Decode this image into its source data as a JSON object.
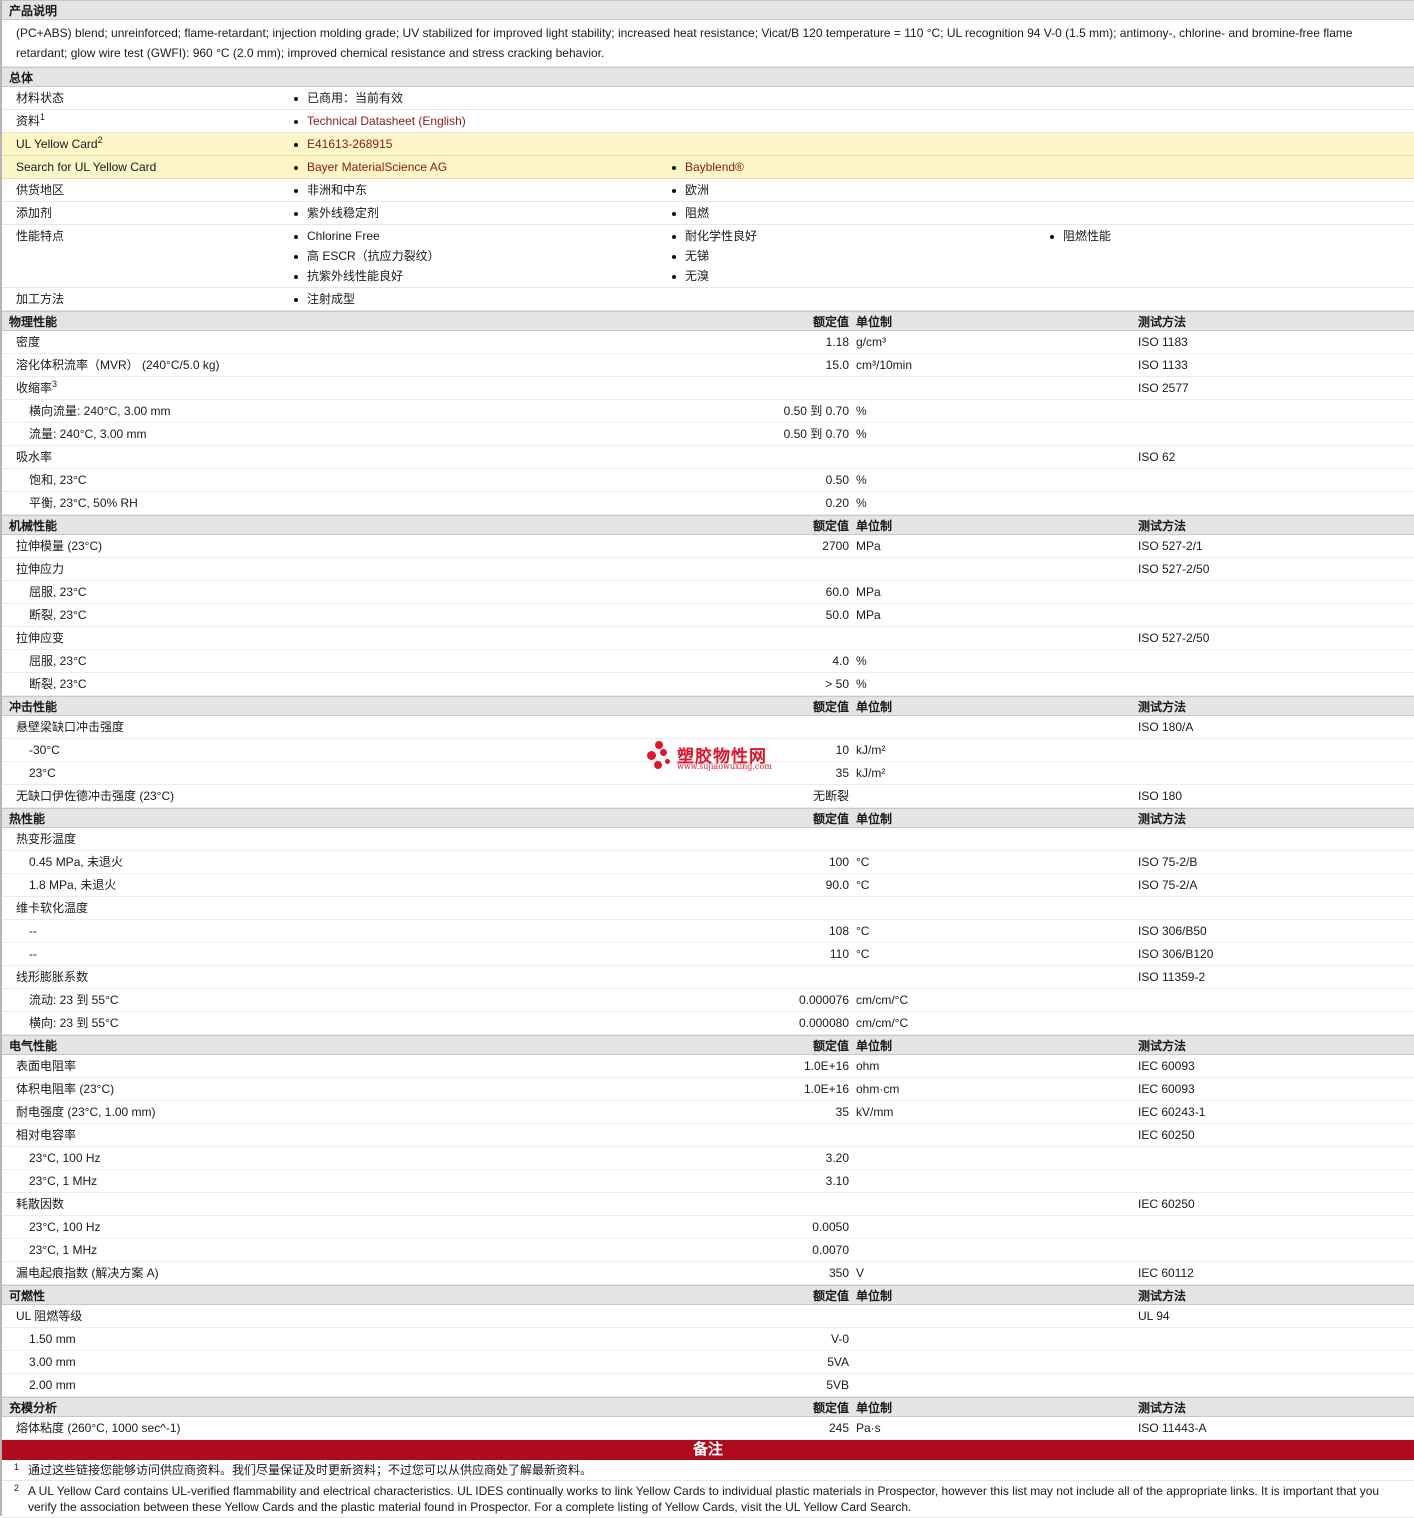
{
  "product_description": {
    "heading": "产品说明",
    "text": "(PC+ABS) blend; unreinforced; flame-retardant; injection molding grade; UV stabilized for improved light stability; increased heat resistance; Vicat/B 120 temperature = 110 °C; UL recognition 94 V-0 (1.5 mm); antimony-, chlorine- and bromine-free flame retardant; glow wire test (GWFI): 960 °C (2.0 mm); improved chemical resistance and stress cracking behavior."
  },
  "general": {
    "heading": "总体",
    "rows": [
      {
        "label": "材料状态",
        "sup": "",
        "highlight": false,
        "cols": [
          [
            "已商用：当前有效"
          ],
          [],
          []
        ],
        "link": false
      },
      {
        "label": "资料",
        "sup": "1",
        "highlight": false,
        "cols": [
          [
            "Technical Datasheet (English)"
          ],
          [],
          []
        ],
        "link": true
      },
      {
        "label": "UL Yellow Card",
        "sup": "2",
        "highlight": true,
        "cols": [
          [
            "E41613-268915"
          ],
          [],
          []
        ],
        "link": true
      },
      {
        "label": "Search for UL Yellow Card",
        "sup": "",
        "highlight": true,
        "cols": [
          [
            "Bayer MaterialScience AG"
          ],
          [
            "Bayblend®"
          ],
          []
        ],
        "link": true
      },
      {
        "label": "供货地区",
        "sup": "",
        "highlight": false,
        "cols": [
          [
            "非洲和中东"
          ],
          [
            "欧洲"
          ],
          []
        ],
        "link": false
      },
      {
        "label": "添加剂",
        "sup": "",
        "highlight": false,
        "cols": [
          [
            "紫外线稳定剂"
          ],
          [
            "阻燃"
          ],
          []
        ],
        "link": false
      },
      {
        "label": "性能特点",
        "sup": "",
        "highlight": false,
        "cols": [
          [
            "Chlorine Free",
            "高 ESCR（抗应力裂纹）",
            "抗紫外线性能良好"
          ],
          [
            "耐化学性良好",
            "无锑",
            "无溴"
          ],
          [
            "阻燃性能"
          ]
        ],
        "link": false
      },
      {
        "label": "加工方法",
        "sup": "",
        "highlight": false,
        "cols": [
          [
            "注射成型"
          ],
          [],
          []
        ],
        "link": false
      }
    ]
  },
  "column_headers": {
    "value": "额定值",
    "unit": "单位制",
    "test": "测试方法"
  },
  "sections": [
    {
      "title": "物理性能",
      "rows": [
        {
          "label": "密度",
          "sub": false,
          "value": "1.18",
          "unit": "g/cm³",
          "test": "ISO 1183"
        },
        {
          "label": "溶化体积流率（MVR） (240°C/5.0 kg)",
          "sub": false,
          "value": "15.0",
          "unit": "cm³/10min",
          "test": "ISO 1133"
        },
        {
          "label": "收缩率",
          "sup": "3",
          "sub": false,
          "value": "",
          "unit": "",
          "test": "ISO 2577"
        },
        {
          "label": "横向流量: 240°C, 3.00 mm",
          "sub": true,
          "value": "0.50 到 0.70",
          "unit": "%",
          "test": ""
        },
        {
          "label": "流量: 240°C, 3.00 mm",
          "sub": true,
          "value": "0.50 到 0.70",
          "unit": "%",
          "test": ""
        },
        {
          "label": "吸水率",
          "sub": false,
          "value": "",
          "unit": "",
          "test": "ISO 62"
        },
        {
          "label": "饱和, 23°C",
          "sub": true,
          "value": "0.50",
          "unit": "%",
          "test": ""
        },
        {
          "label": "平衡, 23°C, 50% RH",
          "sub": true,
          "value": "0.20",
          "unit": "%",
          "test": ""
        }
      ]
    },
    {
      "title": "机械性能",
      "rows": [
        {
          "label": "拉伸模量 (23°C)",
          "sub": false,
          "value": "2700",
          "unit": "MPa",
          "test": "ISO 527-2/1"
        },
        {
          "label": "拉伸应力",
          "sub": false,
          "value": "",
          "unit": "",
          "test": "ISO 527-2/50"
        },
        {
          "label": "屈服, 23°C",
          "sub": true,
          "value": "60.0",
          "unit": "MPa",
          "test": ""
        },
        {
          "label": "断裂, 23°C",
          "sub": true,
          "value": "50.0",
          "unit": "MPa",
          "test": ""
        },
        {
          "label": "拉伸应变",
          "sub": false,
          "value": "",
          "unit": "",
          "test": "ISO 527-2/50"
        },
        {
          "label": "屈服, 23°C",
          "sub": true,
          "value": "4.0",
          "unit": "%",
          "test": ""
        },
        {
          "label": "断裂, 23°C",
          "sub": true,
          "value": "> 50",
          "unit": "%",
          "test": ""
        }
      ]
    },
    {
      "title": "冲击性能",
      "rows": [
        {
          "label": "悬壁梁缺口冲击强度",
          "sub": false,
          "value": "",
          "unit": "",
          "test": "ISO 180/A"
        },
        {
          "label": "-30°C",
          "sub": true,
          "value": "10",
          "unit": "kJ/m²",
          "test": ""
        },
        {
          "label": "23°C",
          "sub": true,
          "value": "35",
          "unit": "kJ/m²",
          "test": ""
        },
        {
          "label": "无缺口伊佐德冲击强度 (23°C)",
          "sub": false,
          "value": "无断裂",
          "unit": "",
          "test": "ISO 180"
        }
      ]
    },
    {
      "title": "热性能",
      "rows": [
        {
          "label": "热变形温度",
          "sub": false,
          "value": "",
          "unit": "",
          "test": ""
        },
        {
          "label": "0.45 MPa, 未退火",
          "sub": true,
          "value": "100",
          "unit": "°C",
          "test": "ISO 75-2/B"
        },
        {
          "label": "1.8 MPa, 未退火",
          "sub": true,
          "value": "90.0",
          "unit": "°C",
          "test": "ISO 75-2/A"
        },
        {
          "label": "维卡软化温度",
          "sub": false,
          "value": "",
          "unit": "",
          "test": ""
        },
        {
          "label": "--",
          "sub": true,
          "value": "108",
          "unit": "°C",
          "test": "ISO 306/B50"
        },
        {
          "label": "--",
          "sub": true,
          "value": "110",
          "unit": "°C",
          "test": "ISO 306/B120"
        },
        {
          "label": "线形膨胀系数",
          "sub": false,
          "value": "",
          "unit": "",
          "test": "ISO 11359-2"
        },
        {
          "label": "流动: 23 到 55°C",
          "sub": true,
          "value": "0.000076",
          "unit": "cm/cm/°C",
          "test": ""
        },
        {
          "label": "横向: 23 到 55°C",
          "sub": true,
          "value": "0.000080",
          "unit": "cm/cm/°C",
          "test": ""
        }
      ]
    },
    {
      "title": "电气性能",
      "rows": [
        {
          "label": "表面电阻率",
          "sub": false,
          "value": "1.0E+16",
          "unit": "ohm",
          "test": "IEC 60093"
        },
        {
          "label": "体积电阻率 (23°C)",
          "sub": false,
          "value": "1.0E+16",
          "unit": "ohm·cm",
          "test": "IEC 60093"
        },
        {
          "label": "耐电强度 (23°C, 1.00 mm)",
          "sub": false,
          "value": "35",
          "unit": "kV/mm",
          "test": "IEC 60243-1"
        },
        {
          "label": "相对电容率",
          "sub": false,
          "value": "",
          "unit": "",
          "test": "IEC 60250"
        },
        {
          "label": "23°C, 100 Hz",
          "sub": true,
          "value": "3.20",
          "unit": "",
          "test": ""
        },
        {
          "label": "23°C, 1 MHz",
          "sub": true,
          "value": "3.10",
          "unit": "",
          "test": ""
        },
        {
          "label": "耗散因数",
          "sub": false,
          "value": "",
          "unit": "",
          "test": "IEC 60250"
        },
        {
          "label": "23°C, 100 Hz",
          "sub": true,
          "value": "0.0050",
          "unit": "",
          "test": ""
        },
        {
          "label": "23°C, 1 MHz",
          "sub": true,
          "value": "0.0070",
          "unit": "",
          "test": ""
        },
        {
          "label": "漏电起痕指数 (解决方案 A)",
          "sub": false,
          "value": "350",
          "unit": "V",
          "test": "IEC 60112"
        }
      ]
    },
    {
      "title": "可燃性",
      "rows": [
        {
          "label": "UL 阻燃等级",
          "sub": false,
          "value": "",
          "unit": "",
          "test": "UL 94"
        },
        {
          "label": "1.50 mm",
          "sub": true,
          "value": "V-0",
          "unit": "",
          "test": ""
        },
        {
          "label": "3.00 mm",
          "sub": true,
          "value": "5VA",
          "unit": "",
          "test": ""
        },
        {
          "label": "2.00 mm",
          "sub": true,
          "value": "5VB",
          "unit": "",
          "test": ""
        }
      ]
    },
    {
      "title": "充模分析",
      "rows": [
        {
          "label": "熔体粘度 (260°C, 1000 sec^-1)",
          "sub": false,
          "value": "245",
          "unit": "Pa·s",
          "test": "ISO 11443-A"
        }
      ]
    }
  ],
  "notes": {
    "heading": "备注",
    "footnotes": [
      {
        "num": "1",
        "text": "通过这些链接您能够访问供应商资料。我们尽量保证及时更新资料；不过您可以从供应商处了解最新资料。"
      },
      {
        "num": "2",
        "text": "A UL Yellow Card contains UL-verified flammability and electrical characteristics. UL IDES continually works to link Yellow Cards to individual plastic materials in Prospector, however this list may not include all of the appropriate links. It is important that you verify the association between these Yellow Cards and the plastic material found in Prospector. For a complete listing of Yellow Cards, visit the UL Yellow Card Search."
      }
    ]
  },
  "watermark": {
    "title": "塑胶物性网",
    "url": "www.sujiaowuxing.com"
  },
  "colors": {
    "link": "#8b1a1a",
    "notes_bar": "#b00a1e",
    "highlight": "#fbf5c8",
    "section_bg": "#e4e4e4",
    "watermark": "#e0142a"
  }
}
